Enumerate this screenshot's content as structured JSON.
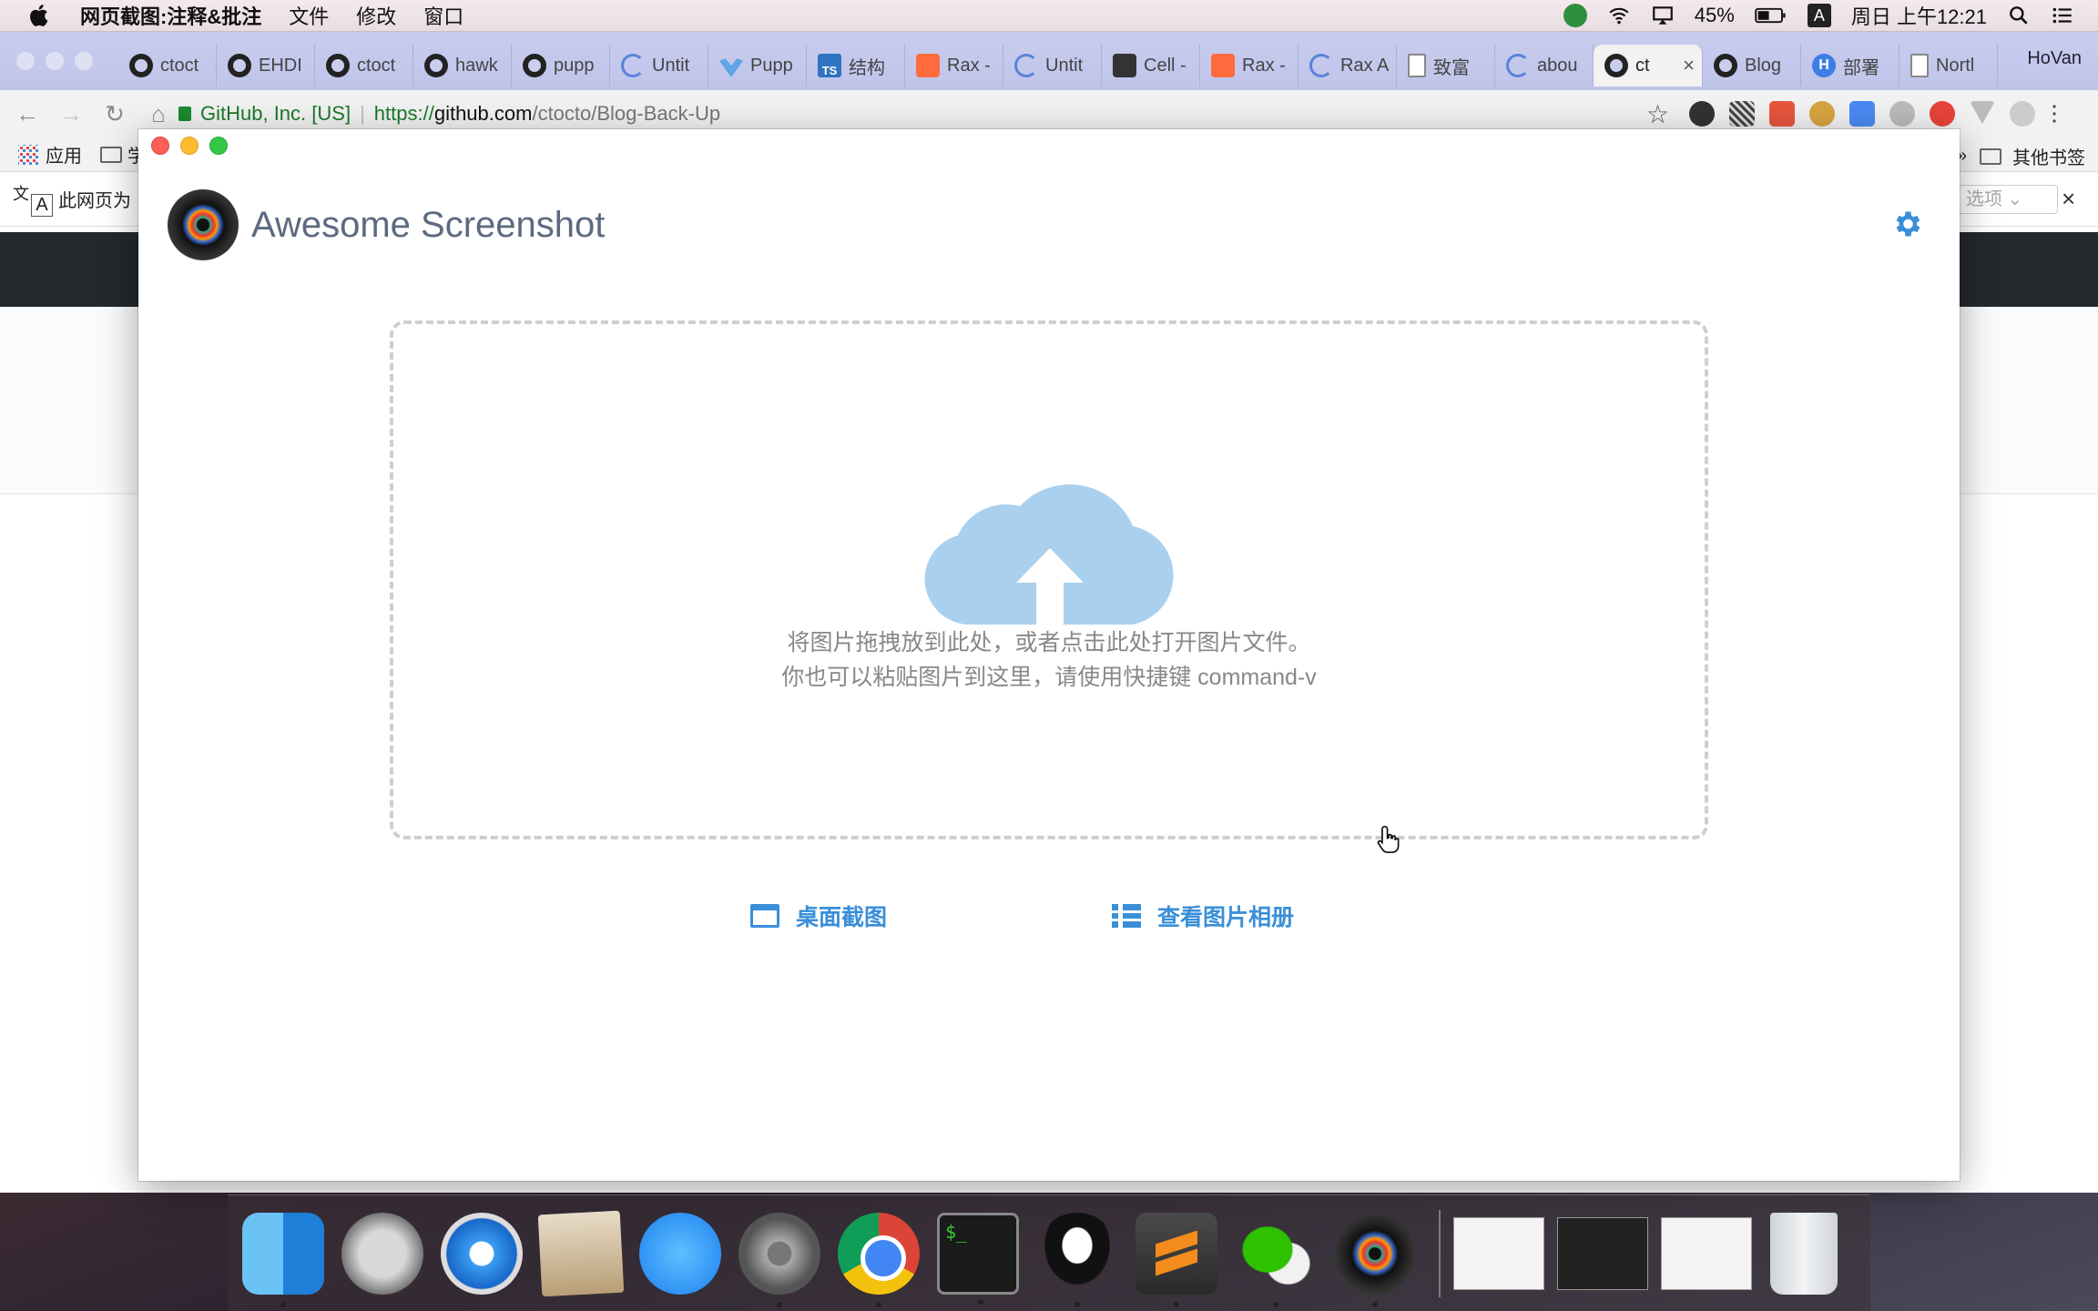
{
  "menubar": {
    "app_name": "网页截图:注释&批注",
    "items": [
      "文件",
      "修改",
      "窗口"
    ],
    "battery": "45%",
    "input_method": "A",
    "clock": "周日 上午12:21"
  },
  "browser": {
    "tabs": [
      {
        "label": "ctoct",
        "favicon": "github-icon"
      },
      {
        "label": "EHDI",
        "favicon": "github-icon"
      },
      {
        "label": "ctoct",
        "favicon": "github-icon"
      },
      {
        "label": "hawk",
        "favicon": "github-icon"
      },
      {
        "label": "pupp",
        "favicon": "github-icon"
      },
      {
        "label": "Untit",
        "favicon": "loading-icon"
      },
      {
        "label": "Pupp",
        "favicon": "puppeteer-icon"
      },
      {
        "label": "结构",
        "favicon": "typescript-icon"
      },
      {
        "label": "Rax -",
        "favicon": "rax-icon"
      },
      {
        "label": "Untit",
        "favicon": "loading-icon"
      },
      {
        "label": "Cell -",
        "favicon": "cell-icon"
      },
      {
        "label": "Rax -",
        "favicon": "rax-icon"
      },
      {
        "label": "Rax A",
        "favicon": "loading-icon"
      },
      {
        "label": "致富",
        "favicon": "document-icon"
      },
      {
        "label": "abou",
        "favicon": "loading-icon"
      },
      {
        "label": "ct",
        "favicon": "github-icon",
        "active": true
      },
      {
        "label": "Blog",
        "favicon": "github-icon"
      },
      {
        "label": "部署",
        "favicon": "h-icon"
      },
      {
        "label": "Nortl",
        "favicon": "document-icon"
      }
    ],
    "profile_name": "HoVan",
    "address": {
      "secure_label": "GitHub, Inc. [US]",
      "scheme": "https://",
      "host": "github.com",
      "path": "/ctocto/Blog-Back-Up"
    },
    "bookmarks": {
      "apps_label": "应用",
      "folder_partial": "学",
      "other_label": "其他书签"
    },
    "translate": {
      "message": "此网页为",
      "options_label": "选项"
    }
  },
  "extension": {
    "title": "Awesome Screenshot",
    "dropzone": {
      "line1": "将图片拖拽放到此处，或者点击此处打开图片文件。",
      "line2": "你也可以粘贴图片到这里，请使用快捷键 command-v"
    },
    "actions": {
      "desktop_capture": "桌面截图",
      "view_album": "查看图片相册"
    },
    "accent_color": "#3a8fd8"
  },
  "dock": {
    "terminal_prompt": "$_"
  }
}
